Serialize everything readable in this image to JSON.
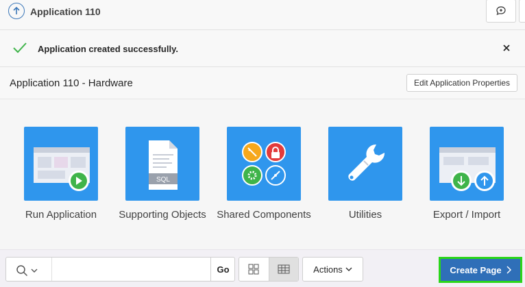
{
  "header": {
    "app_title": "Application 110"
  },
  "alert": {
    "message": "Application created successfully."
  },
  "region": {
    "title": "Application 110 - Hardware",
    "edit_button": "Edit Application Properties"
  },
  "tiles": [
    {
      "label": "Run Application",
      "icon": "run-application-icon"
    },
    {
      "label": "Supporting Objects",
      "icon": "supporting-objects-icon"
    },
    {
      "label": "Shared Components",
      "icon": "shared-components-icon"
    },
    {
      "label": "Utilities",
      "icon": "utilities-icon"
    },
    {
      "label": "Export / Import",
      "icon": "export-import-icon"
    }
  ],
  "sql_badge": "SQL",
  "toolbar": {
    "search_value": "",
    "go_label": "Go",
    "actions_label": "Actions",
    "create_page_label": "Create Page"
  },
  "colors": {
    "tile": "#2f96ed",
    "primary_button": "#2f6fb8",
    "success": "#3fb44a",
    "highlight": "#2ad61a"
  }
}
